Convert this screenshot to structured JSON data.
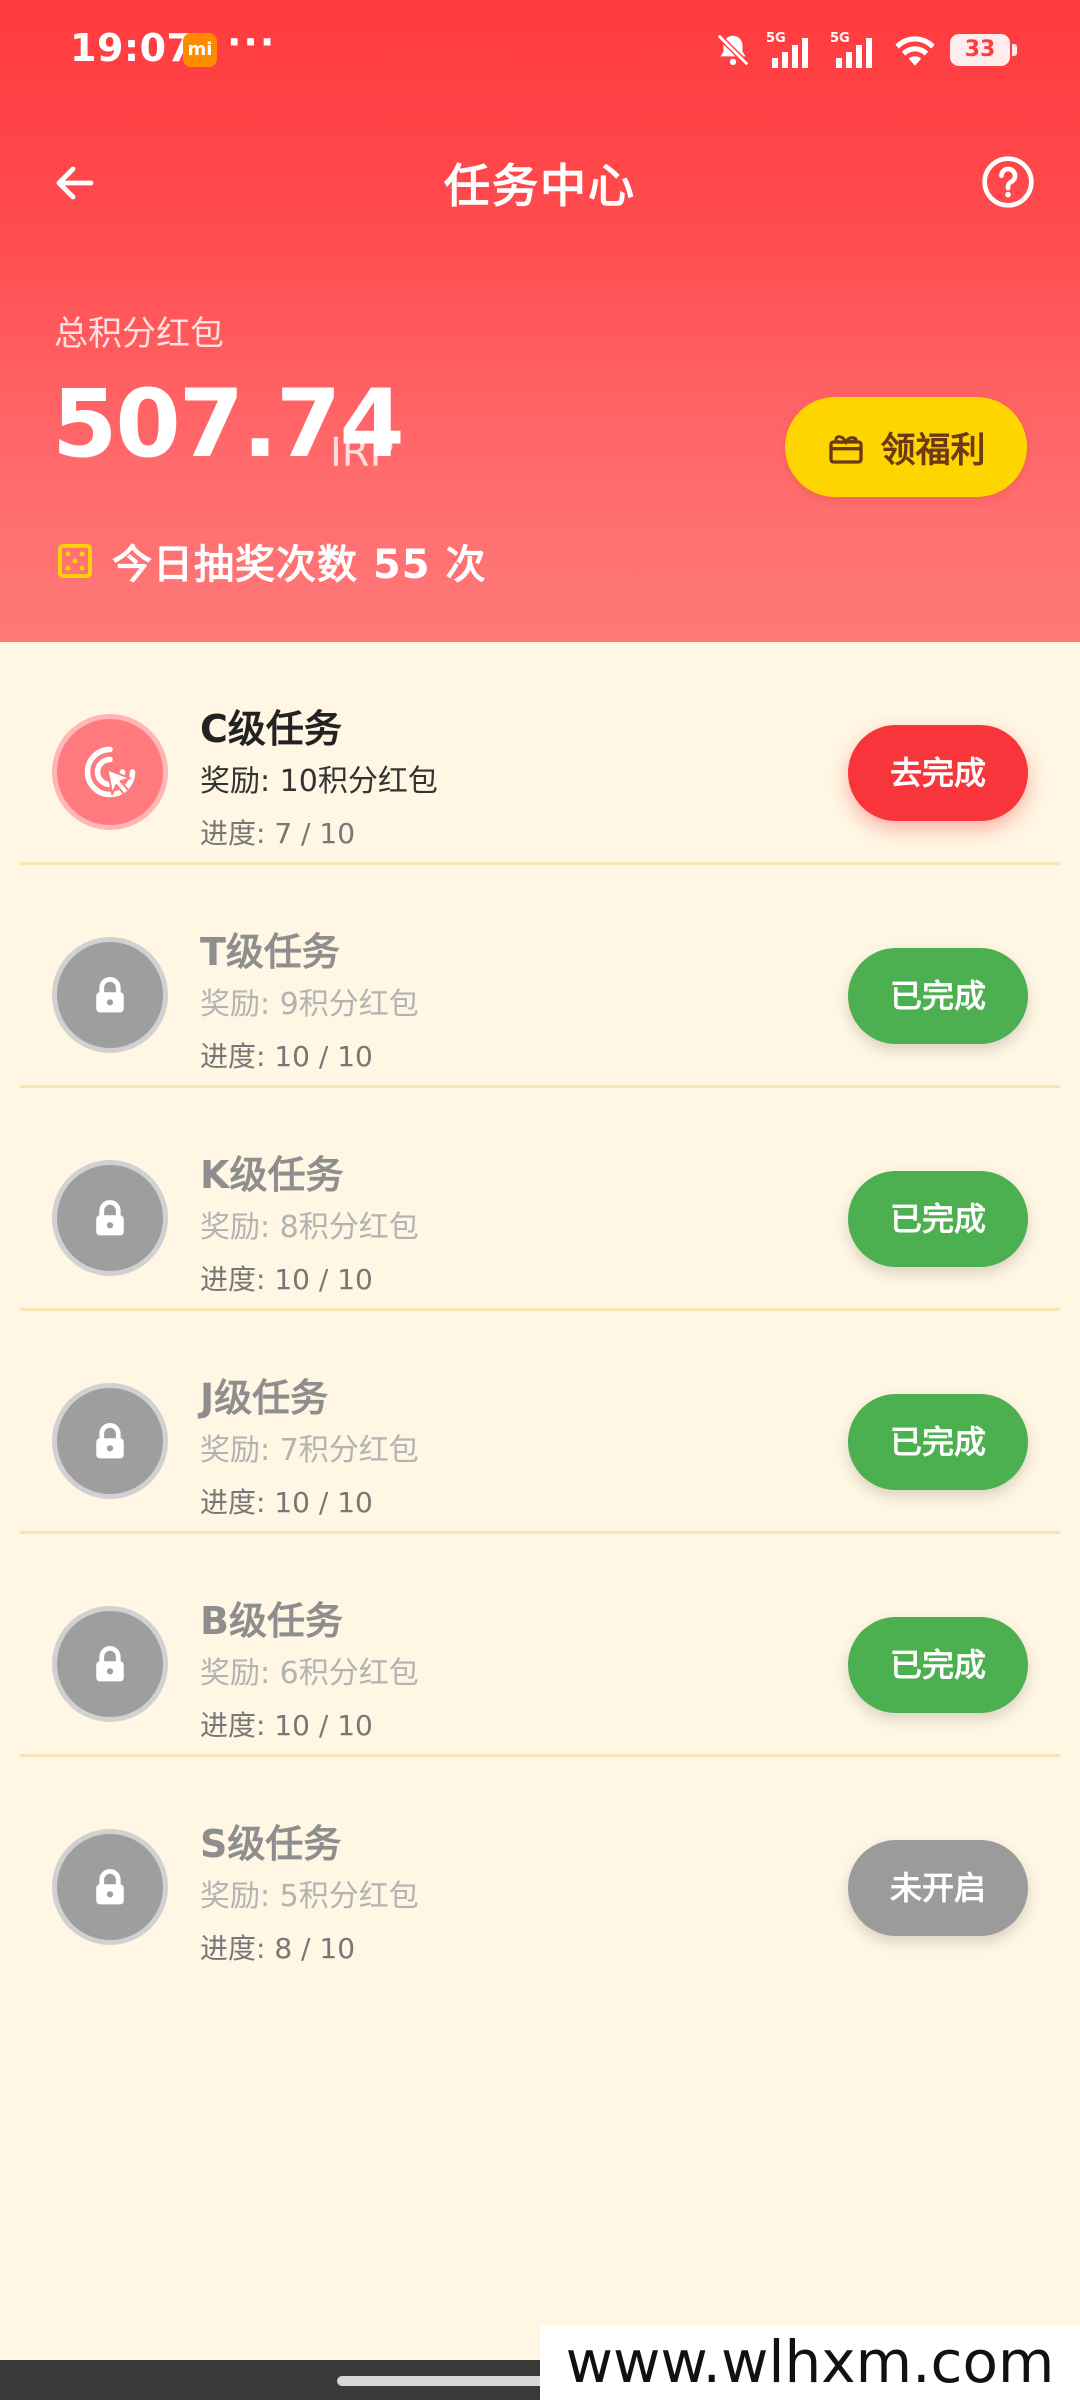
{
  "status_bar": {
    "time": "19:07",
    "app_badge": "mi",
    "more": "···",
    "battery": "33"
  },
  "nav": {
    "title": "任务中心"
  },
  "summary": {
    "label": "总积分红包",
    "value": "507.74",
    "unit": "IRP",
    "welfare_button": "领福利",
    "lottery_text": "今日抽奖次数 55 次"
  },
  "tasks": [
    {
      "name": "C级任务",
      "reward": "奖励: 10积分红包",
      "progress": "进度: 7 / 10",
      "button": "去完成"
    },
    {
      "name": "T级任务",
      "reward": "奖励: 9积分红包",
      "progress": "进度: 10 / 10",
      "button": "已完成"
    },
    {
      "name": "K级任务",
      "reward": "奖励: 8积分红包",
      "progress": "进度: 10 / 10",
      "button": "已完成"
    },
    {
      "name": "J级任务",
      "reward": "奖励: 7积分红包",
      "progress": "进度: 10 / 10",
      "button": "已完成"
    },
    {
      "name": "B级任务",
      "reward": "奖励: 6积分红包",
      "progress": "进度: 10 / 10",
      "button": "已完成"
    },
    {
      "name": "S级任务",
      "reward": "奖励: 5积分红包",
      "progress": "进度: 8 / 10",
      "button": "未开启"
    }
  ],
  "watermark": "www.wlhxm.com",
  "colors": {
    "header_red": "#FF3B3E",
    "accent_yellow": "#FFD500",
    "done_green": "#4CAF50",
    "go_red": "#F8353A",
    "disabled_gray": "#9B9B9B",
    "page_bg": "#FFF6E3"
  },
  "icons": {
    "back": "arrow-left-icon",
    "help": "question-circle-icon",
    "welfare": "gift-box-icon",
    "lottery": "dice-icon",
    "task_active": "tap-cursor-icon",
    "task_locked": "lock-icon"
  }
}
